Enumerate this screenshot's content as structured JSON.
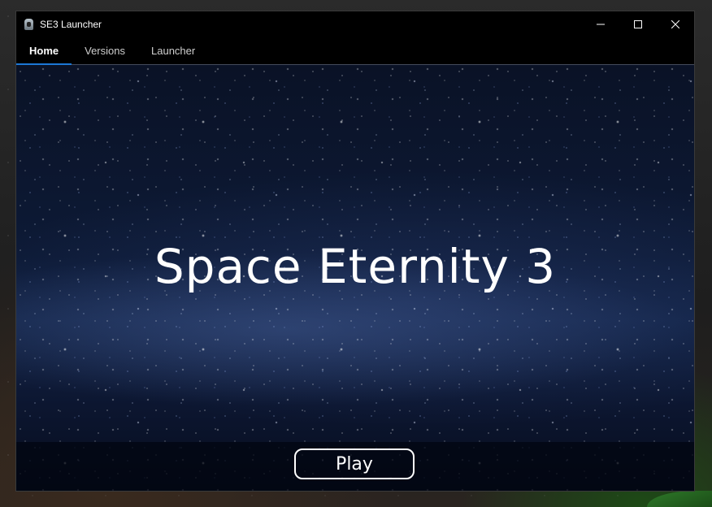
{
  "window": {
    "title": "SE3 Launcher",
    "app_icon": "launcher-icon",
    "controls": {
      "minimize_icon": "minimize-icon",
      "maximize_icon": "maximize-icon",
      "close_icon": "close-icon"
    }
  },
  "tabs": [
    {
      "label": "Home",
      "active": true
    },
    {
      "label": "Versions",
      "active": false
    },
    {
      "label": "Launcher",
      "active": false
    }
  ],
  "main": {
    "game_title": "Space Eternity 3"
  },
  "footer": {
    "play_label": "Play"
  },
  "colors": {
    "accent": "#1c78d6",
    "titlebar": "#000000",
    "text": "#ffffff"
  }
}
